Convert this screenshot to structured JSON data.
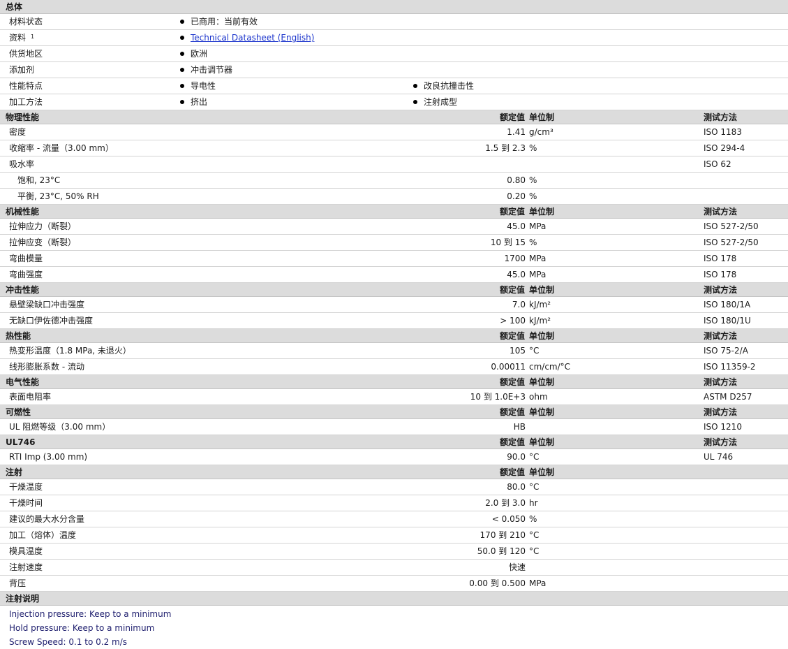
{
  "general": {
    "title": "总体",
    "rows": [
      {
        "label": "材料状态",
        "items": [
          "已商用：当前有效"
        ]
      },
      {
        "label": "资料",
        "sup": "1",
        "items": [
          "Technical Datasheet (English)"
        ],
        "link": true
      },
      {
        "label": "供货地区",
        "items": [
          "欧洲"
        ]
      },
      {
        "label": "添加剂",
        "items": [
          "冲击调节器"
        ]
      },
      {
        "label": "性能特点",
        "items": [
          "导电性",
          "改良抗撞击性"
        ]
      },
      {
        "label": "加工方法",
        "items": [
          "挤出",
          "注射成型"
        ]
      }
    ]
  },
  "headers": {
    "value": "额定值",
    "unit": "单位制",
    "test": "测试方法"
  },
  "sections": [
    {
      "title": "物理性能",
      "rows": [
        {
          "label": "密度",
          "value": "1.41",
          "unit": "g/cm³",
          "test": "ISO 1183"
        },
        {
          "label": "收缩率  - 流量（3.00 mm）",
          "value": "1.5 到  2.3",
          "unit": "%",
          "test": "ISO 294-4"
        },
        {
          "label": "吸水率",
          "value": "",
          "unit": "",
          "test": "ISO 62"
        },
        {
          "label": "饱和, 23°C",
          "value": "0.80",
          "unit": "%",
          "test": "",
          "sub": true
        },
        {
          "label": "平衡, 23°C, 50% RH",
          "value": "0.20",
          "unit": "%",
          "test": "",
          "sub": true
        }
      ]
    },
    {
      "title": "机械性能",
      "rows": [
        {
          "label": "拉伸应力（断裂）",
          "value": "45.0",
          "unit": "MPa",
          "test": "ISO 527-2/50"
        },
        {
          "label": "拉伸应变（断裂）",
          "value": "10 到  15",
          "unit": "%",
          "test": "ISO 527-2/50"
        },
        {
          "label": "弯曲模量",
          "value": "1700",
          "unit": "MPa",
          "test": "ISO 178"
        },
        {
          "label": "弯曲强度",
          "value": "45.0",
          "unit": "MPa",
          "test": "ISO 178"
        }
      ]
    },
    {
      "title": "冲击性能",
      "rows": [
        {
          "label": "悬壁梁缺口冲击强度",
          "value": "7.0",
          "unit": "kJ/m²",
          "test": "ISO 180/1A"
        },
        {
          "label": "无缺口伊佐德冲击强度",
          "value": "> 100",
          "unit": "kJ/m²",
          "test": "ISO 180/1U"
        }
      ]
    },
    {
      "title": "热性能",
      "rows": [
        {
          "label": "热变形温度（1.8 MPa, 未退火）",
          "value": "105",
          "unit": "°C",
          "test": "ISO 75-2/A"
        },
        {
          "label": "线形膨胀系数  - 流动",
          "value": "0.00011",
          "unit": "cm/cm/°C",
          "test": "ISO 11359-2"
        }
      ]
    },
    {
      "title": "电气性能",
      "rows": [
        {
          "label": "表面电阻率",
          "value": "10 到  1.0E+3",
          "unit": "ohm",
          "test": "ASTM D257"
        }
      ]
    },
    {
      "title": "可燃性",
      "rows": [
        {
          "label": "UL 阻燃等级（3.00 mm）",
          "value": "HB",
          "unit": "",
          "test": "ISO 1210",
          "blue": true
        }
      ]
    },
    {
      "title": "UL746",
      "rows": [
        {
          "label": "RTI Imp (3.00 mm)",
          "value": "90.0",
          "unit": "°C",
          "test": "UL 746",
          "blue": true
        }
      ]
    },
    {
      "title": "注射",
      "noTest": true,
      "rows": [
        {
          "label": "干燥温度",
          "value": "80.0",
          "unit": "°C",
          "test": ""
        },
        {
          "label": "干燥时间",
          "value": "2.0 到  3.0",
          "unit": "hr",
          "test": ""
        },
        {
          "label": "建议的最大水分含量",
          "value": "< 0.050",
          "unit": "%",
          "test": ""
        },
        {
          "label": "加工（熔体）温度",
          "value": "170 到  210",
          "unit": "°C",
          "test": ""
        },
        {
          "label": "模具温度",
          "value": "50.0 到  120",
          "unit": "°C",
          "test": ""
        },
        {
          "label": "注射速度",
          "value": "快速",
          "unit": "",
          "test": ""
        },
        {
          "label": "背压",
          "value": "0.00 到  0.500",
          "unit": "MPa",
          "test": ""
        }
      ]
    }
  ],
  "notes": {
    "title": "注射说明",
    "lines": [
      "Injection pressure: Keep to a minimum",
      "Hold pressure: Keep to a minimum",
      "Screw Speed: 0.1 to 0.2 m/s"
    ]
  }
}
